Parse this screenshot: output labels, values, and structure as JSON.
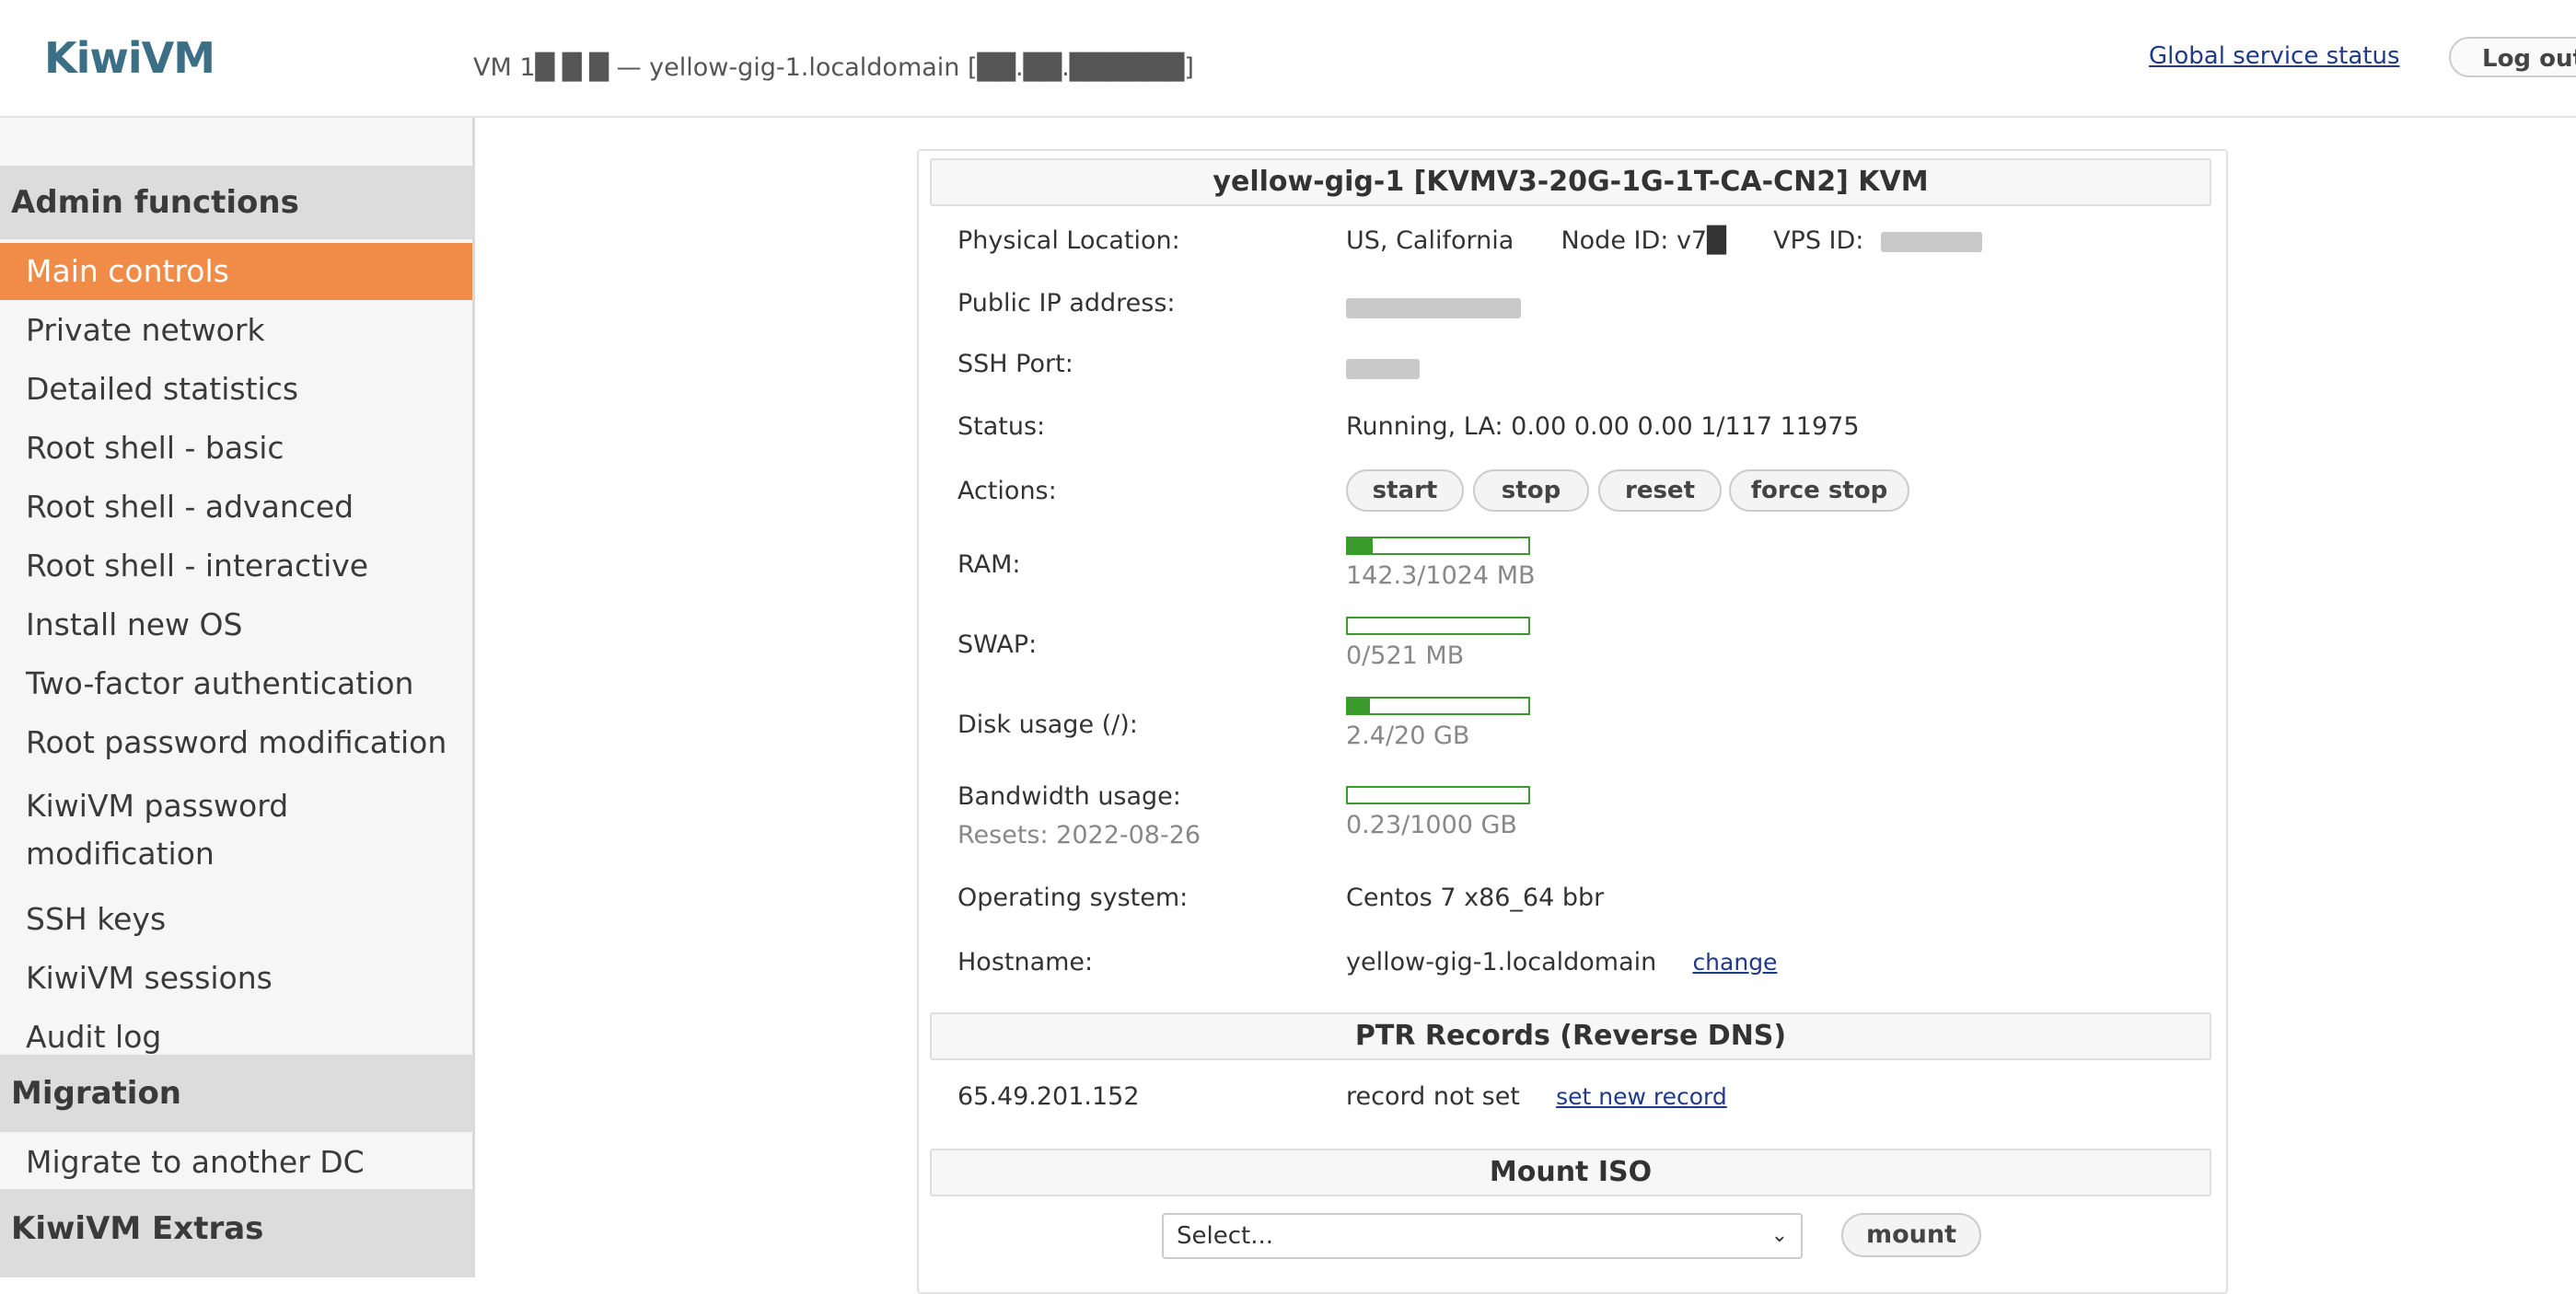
{
  "header": {
    "logo": "KiwiVM",
    "vm_title": "VM 1█ █ █  — yellow-gig-1.localdomain [██.██.██████]",
    "global_status": "Global service status",
    "logout": "Log out"
  },
  "sidebar": {
    "sections": [
      {
        "title": "Admin functions",
        "items": [
          {
            "label": "Main controls",
            "active": true
          },
          {
            "label": "Private network"
          },
          {
            "label": "Detailed statistics"
          },
          {
            "label": "Root shell - basic"
          },
          {
            "label": "Root shell - advanced"
          },
          {
            "label": "Root shell - interactive"
          },
          {
            "label": "Install new OS"
          },
          {
            "label": "Two-factor authentication"
          },
          {
            "label": "Root password modification"
          },
          {
            "label": "KiwiVM password modification"
          },
          {
            "label": "SSH keys"
          },
          {
            "label": "KiwiVM sessions"
          },
          {
            "label": "Audit log"
          }
        ]
      },
      {
        "title": "Migration",
        "items": [
          {
            "label": "Migrate to another DC"
          }
        ]
      },
      {
        "title": "KiwiVM Extras",
        "items": []
      }
    ]
  },
  "main": {
    "title": "yellow-gig-1   [KVMV3-20G-1G-1T-CA-CN2]   KVM",
    "location": {
      "label": "Physical Location:",
      "value": "US, California",
      "node_label": "Node ID: v7█",
      "vps_label": "VPS ID:"
    },
    "public_ip": {
      "label": "Public IP address:"
    },
    "ssh_port": {
      "label": "SSH Port:"
    },
    "status": {
      "label": "Status:",
      "value": "Running, LA: 0.00 0.00 0.00 1/117 11975"
    },
    "actions": {
      "label": "Actions:",
      "buttons": [
        "start",
        "stop",
        "reset",
        "force stop"
      ]
    },
    "ram": {
      "label": "RAM:",
      "value": "142.3/1024 MB",
      "fraction": 0.139
    },
    "swap": {
      "label": "SWAP:",
      "value": "0/521 MB",
      "fraction": 0.0
    },
    "disk": {
      "label": "Disk usage (/):",
      "value": "2.4/20 GB",
      "fraction": 0.12
    },
    "bandwidth": {
      "label": "Bandwidth usage:",
      "resets": "Resets: 2022-08-26",
      "value": "0.23/1000 GB",
      "fraction": 0.0002
    },
    "os": {
      "label": "Operating system:",
      "value": "Centos 7 x86_64 bbr"
    },
    "hostname": {
      "label": "Hostname:",
      "value": "yellow-gig-1.localdomain",
      "change": "change"
    },
    "ptr": {
      "title": "PTR Records (Reverse DNS)",
      "ip": "65.49.201.152",
      "status": "record not set",
      "set_link": "set new record"
    },
    "iso": {
      "title": "Mount ISO",
      "select_value": "Select...",
      "mount_button": "mount"
    }
  },
  "colors": {
    "accent": "#f08c47",
    "meter_green": "#3a9a2c",
    "logo": "#3b6f86",
    "link": "#1f3a8a"
  }
}
